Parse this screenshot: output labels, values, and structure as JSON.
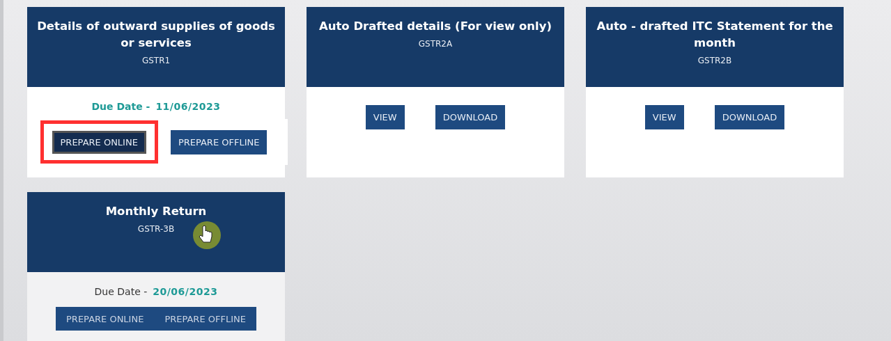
{
  "cards": [
    {
      "title": "Details of outward supplies of goods or services",
      "code": "GSTR1",
      "due": {
        "label": "Due Date -",
        "date": "11/06/2023",
        "label_highlighted": true
      },
      "kind": "separate",
      "cursor": false,
      "buttons": [
        {
          "label": "PREPARE ONLINE",
          "highlighted": true
        },
        {
          "label": "PREPARE OFFLINE",
          "highlighted": false
        }
      ]
    },
    {
      "title": "Auto Drafted details (For view only)",
      "code": "GSTR2A",
      "kind": "separate",
      "cursor": false,
      "buttons": [
        {
          "label": "VIEW",
          "highlighted": false
        },
        {
          "label": "DOWNLOAD",
          "highlighted": false
        }
      ]
    },
    {
      "title": "Auto - drafted ITC Statement for the month",
      "code": "GSTR2B",
      "kind": "separate",
      "cursor": false,
      "buttons": [
        {
          "label": "VIEW",
          "highlighted": false
        },
        {
          "label": "DOWNLOAD",
          "highlighted": false
        }
      ]
    },
    {
      "title": "Monthly Return",
      "code": "GSTR-3B",
      "due": {
        "label": "Due Date -",
        "date": "20/06/2023",
        "label_highlighted": false
      },
      "kind": "joined",
      "cursor": true,
      "buttons": [
        {
          "label": "PREPARE ONLINE",
          "highlighted": false
        },
        {
          "label": "PREPARE OFFLINE",
          "highlighted": false
        }
      ]
    }
  ]
}
